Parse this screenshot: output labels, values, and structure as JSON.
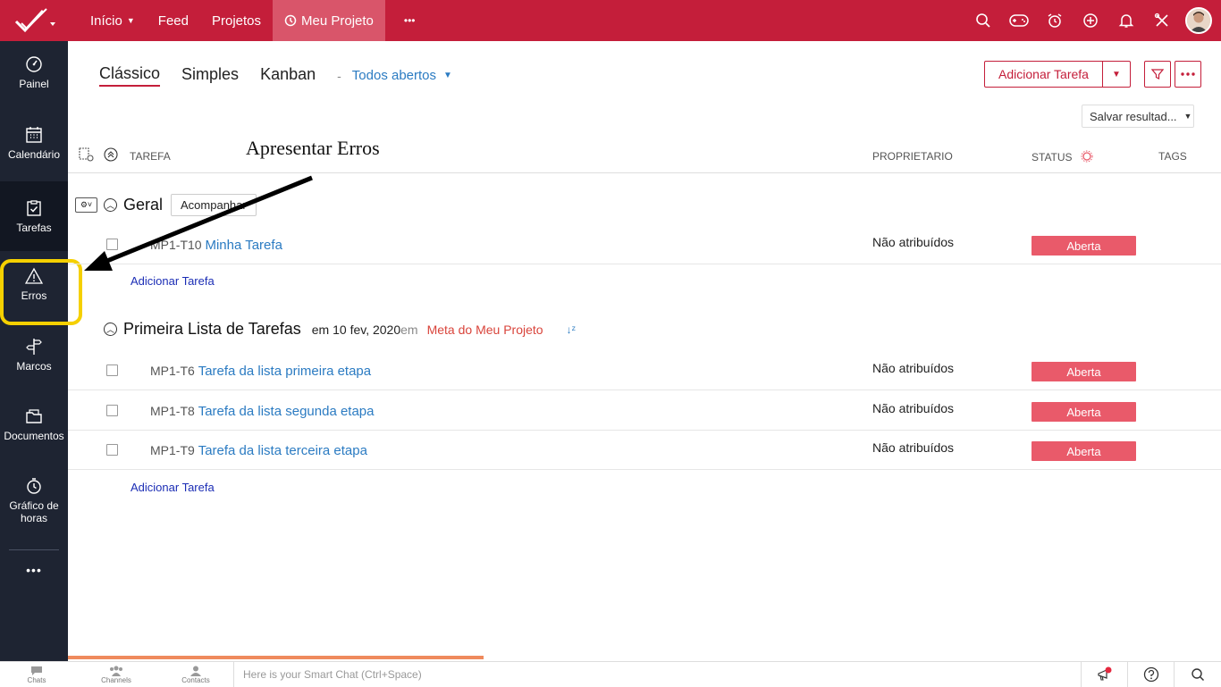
{
  "topbar": {
    "logo_icon": "zoho-projects-check-icon",
    "nav": [
      {
        "label": "Início",
        "has_caret": true
      },
      {
        "label": "Feed"
      },
      {
        "label": "Projetos"
      },
      {
        "label": "Meu Projeto",
        "active": true
      },
      {
        "label": "•••"
      }
    ],
    "icons": [
      "search-icon",
      "gamepad-icon",
      "alarm-icon",
      "add-circle-icon",
      "bell-icon",
      "tools-icon"
    ],
    "accent_color": "#c41e3a"
  },
  "sidebar": {
    "items": [
      {
        "label": "Painel",
        "icon": "dashboard-icon"
      },
      {
        "label": "Calendário",
        "icon": "calendar-icon"
      },
      {
        "label": "Tarefas",
        "icon": "tasks-icon",
        "active": true
      },
      {
        "label": "Erros",
        "icon": "warning-icon"
      },
      {
        "label": "Marcos",
        "icon": "milestone-icon"
      },
      {
        "label": "Documentos",
        "icon": "documents-icon"
      },
      {
        "label": "Gráfico de horas",
        "icon": "timer-icon"
      }
    ],
    "more": "•••"
  },
  "views": {
    "tabs": [
      "Clássico",
      "Simples",
      "Kanban"
    ],
    "active_tab": "Clássico",
    "separator": "-",
    "filter_label": "Todos abertos"
  },
  "toolbar": {
    "add_task_label": "Adicionar Tarefa",
    "save_results_label": "Salvar resultad..."
  },
  "table": {
    "headers": {
      "task": "TAREFA",
      "owner": "PROPRIETARIO",
      "status": "STATUS",
      "tags": "TAGS"
    }
  },
  "annotation": {
    "text": "Apresentar  Erros"
  },
  "groups": [
    {
      "title": "Geral",
      "follow_label": "Acompanhar",
      "tasks": [
        {
          "id": "MP1-T10",
          "name": "Minha Tarefa",
          "owner": "Não atribuídos",
          "status": "Aberta"
        }
      ],
      "add_label": "Adicionar Tarefa"
    },
    {
      "title": "Primeira Lista de Tarefas",
      "date_text": "em 10 fev, 2020",
      "em_text": "em",
      "goal": "Meta do Meu Projeto",
      "tasks": [
        {
          "id": "MP1-T6",
          "name": "Tarefa da lista primeira etapa",
          "owner": "Não atribuídos",
          "status": "Aberta"
        },
        {
          "id": "MP1-T8",
          "name": "Tarefa da lista segunda etapa",
          "owner": "Não atribuídos",
          "status": "Aberta"
        },
        {
          "id": "MP1-T9",
          "name": "Tarefa da lista terceira etapa",
          "owner": "Não atribuídos",
          "status": "Aberta"
        }
      ],
      "add_label": "Adicionar Tarefa"
    }
  ],
  "bottombar": {
    "items": [
      "Chats",
      "Channels",
      "Contacts"
    ],
    "smart_chat_placeholder": "Here is your Smart Chat (Ctrl+Space)"
  }
}
